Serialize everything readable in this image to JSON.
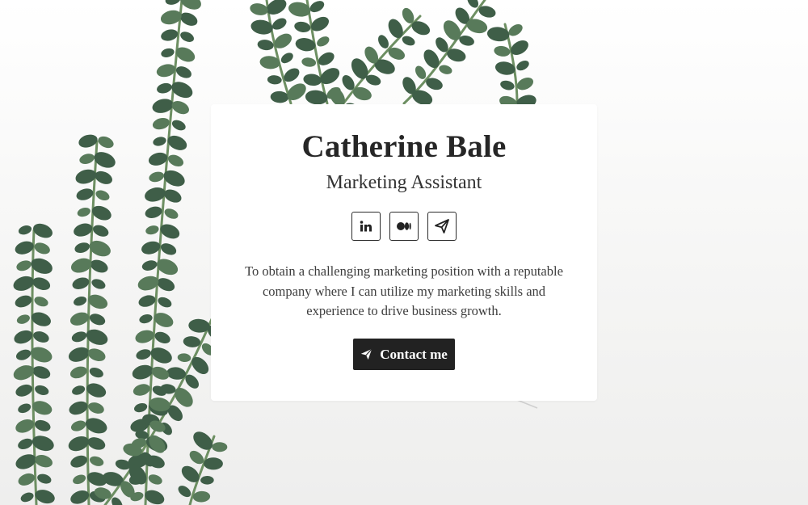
{
  "profile": {
    "name": "Catherine Bale",
    "role": "Marketing Assistant",
    "objective": "To obtain a challenging marketing position with a reputable company where I can utilize my marketing skills and experience to drive business growth."
  },
  "socials": [
    {
      "icon": "linkedin-icon",
      "label": "in"
    },
    {
      "icon": "medium-icon"
    },
    {
      "icon": "telegram-icon"
    }
  ],
  "contact": {
    "label": "Contact me",
    "icon": "paper-plane-icon"
  },
  "colors": {
    "text_dark": "#262626",
    "button_bg": "#222222",
    "button_text": "#ffffff",
    "card_bg": "#ffffff",
    "leaf": "#3f5e48"
  }
}
